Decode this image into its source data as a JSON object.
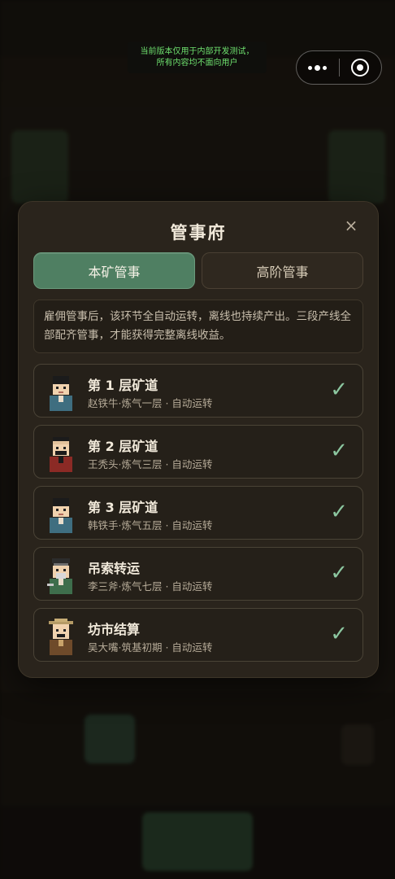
{
  "dev_notice": {
    "line1": "当前版本仅用于内部开发测试，",
    "line2": "所有内容均不面向用户"
  },
  "capsule": {
    "more_icon": "more-dots-icon",
    "close_icon": "target-circle-icon"
  },
  "modal": {
    "title": "管事府",
    "close_label": "×",
    "tabs": [
      {
        "label": "本矿管事",
        "active": true
      },
      {
        "label": "高阶管事",
        "active": false
      }
    ],
    "description": "雇佣管事后，该环节全自动运转，离线也持续产出。三段产线全部配齐管事，才能获得完整离线收益。",
    "items": [
      {
        "title": "第 1 层矿道",
        "subtitle": "赵铁牛·炼气一层 · 自动运转",
        "check": "✓",
        "avatar": "miner-avatar-blue"
      },
      {
        "title": "第 2 层矿道",
        "subtitle": "王秃头·炼气三层 · 自动运转",
        "check": "✓",
        "avatar": "miner-avatar-red"
      },
      {
        "title": "第 3 层矿道",
        "subtitle": "韩铁手·炼气五层 · 自动运转",
        "check": "✓",
        "avatar": "miner-avatar-blue"
      },
      {
        "title": "吊索转运",
        "subtitle": "李三斧·炼气七层 · 自动运转",
        "check": "✓",
        "avatar": "elder-avatar-green"
      },
      {
        "title": "坊市结算",
        "subtitle": "吴大嘴·筑基初期 · 自动运转",
        "check": "✓",
        "avatar": "merchant-avatar-brown"
      }
    ]
  },
  "colors": {
    "accent_green": "#4f7f62",
    "check_green": "#8cc7a0",
    "modal_bg": "#2a241c"
  }
}
